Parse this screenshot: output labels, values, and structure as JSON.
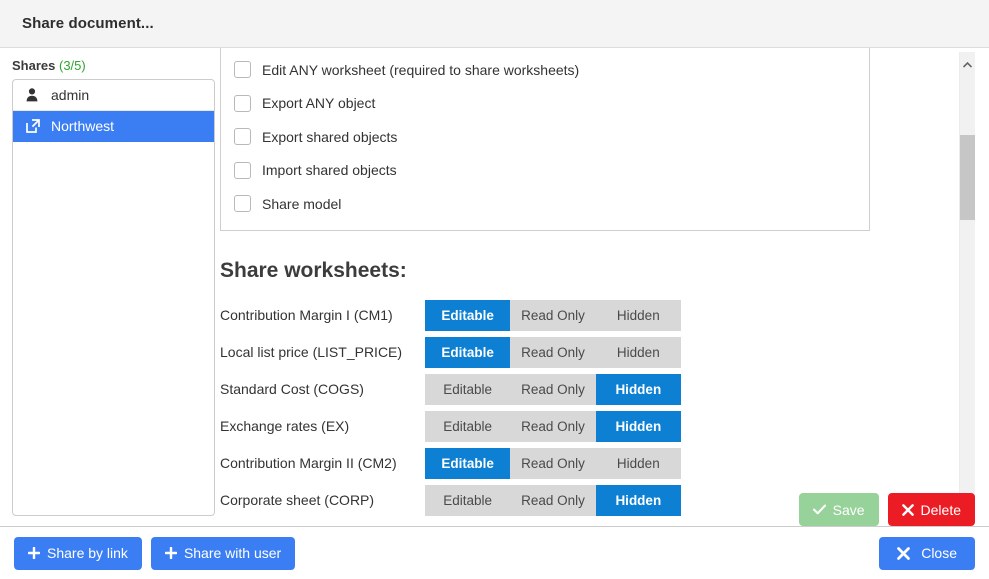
{
  "header": {
    "title": "Share document..."
  },
  "sidebar": {
    "label": "Shares",
    "count": "(3/5)",
    "items": [
      {
        "label": "admin",
        "icon": "user-icon",
        "selected": false
      },
      {
        "label": "Northwest",
        "icon": "external-link-icon",
        "selected": true
      }
    ]
  },
  "permissions": {
    "items": [
      {
        "label": "Edit ANY worksheet (required to share worksheets)",
        "checked": false
      },
      {
        "label": "Export ANY object",
        "checked": false
      },
      {
        "label": "Export shared objects",
        "checked": false
      },
      {
        "label": "Import shared objects",
        "checked": false
      },
      {
        "label": "Share model",
        "checked": false
      }
    ]
  },
  "worksheets": {
    "heading": "Share worksheets:",
    "options": [
      "Editable",
      "Read Only",
      "Hidden"
    ],
    "rows": [
      {
        "name": "Contribution Margin I (CM1)",
        "selected": "Editable"
      },
      {
        "name": "Local list price (LIST_PRICE)",
        "selected": "Editable"
      },
      {
        "name": "Standard Cost (COGS)",
        "selected": "Hidden"
      },
      {
        "name": "Exchange rates (EX)",
        "selected": "Hidden"
      },
      {
        "name": "Contribution Margin II (CM2)",
        "selected": "Editable"
      },
      {
        "name": "Corporate sheet (CORP)",
        "selected": "Hidden"
      }
    ]
  },
  "actions": {
    "save": "Save",
    "delete": "Delete"
  },
  "footer": {
    "share_by_link": "Share by link",
    "share_with_user": "Share with user",
    "close": "Close"
  },
  "colors": {
    "accent_blue": "#0d80d4",
    "select_blue": "#3b7ef3",
    "save_green": "#97d29a",
    "delete_red": "#ec1c24",
    "count_green": "#2ea62e",
    "segment_gray": "#d8d8d8"
  }
}
